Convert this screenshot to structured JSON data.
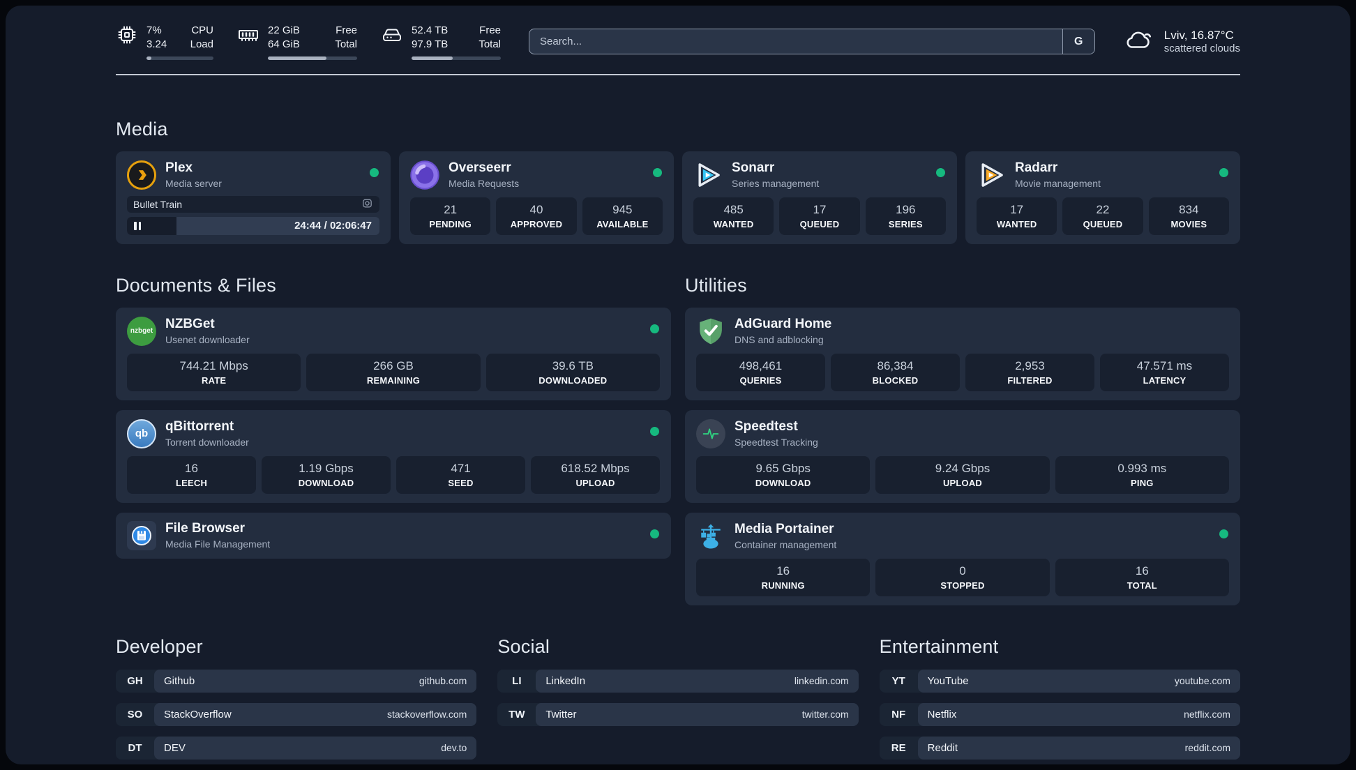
{
  "header": {
    "cpu": {
      "value_top": "7%",
      "value_bottom": "3.24",
      "label_top": "CPU",
      "label_bottom": "Load",
      "progress": 7
    },
    "ram": {
      "value_top": "22 GiB",
      "value_bottom": "64 GiB",
      "label_top": "Free",
      "label_bottom": "Total",
      "progress": 66
    },
    "disk": {
      "value_top": "52.4 TB",
      "value_bottom": "97.9 TB",
      "label_top": "Free",
      "label_bottom": "Total",
      "progress": 46
    },
    "search": {
      "placeholder": "Search...",
      "engine": "G"
    },
    "weather": {
      "location_temp": "Lviv, 16.87°C",
      "condition": "scattered clouds"
    }
  },
  "media": {
    "title": "Media",
    "plex": {
      "title": "Plex",
      "subtitle": "Media server",
      "now_playing": "Bullet Train",
      "time": "24:44 / 02:06:47",
      "progress": 19.5
    },
    "overseerr": {
      "title": "Overseerr",
      "subtitle": "Media Requests",
      "stats": [
        {
          "value": "21",
          "label": "PENDING"
        },
        {
          "value": "40",
          "label": "APPROVED"
        },
        {
          "value": "945",
          "label": "AVAILABLE"
        }
      ]
    },
    "sonarr": {
      "title": "Sonarr",
      "subtitle": "Series management",
      "stats": [
        {
          "value": "485",
          "label": "WANTED"
        },
        {
          "value": "17",
          "label": "QUEUED"
        },
        {
          "value": "196",
          "label": "SERIES"
        }
      ]
    },
    "radarr": {
      "title": "Radarr",
      "subtitle": "Movie management",
      "stats": [
        {
          "value": "17",
          "label": "WANTED"
        },
        {
          "value": "22",
          "label": "QUEUED"
        },
        {
          "value": "834",
          "label": "MOVIES"
        }
      ]
    }
  },
  "documents": {
    "title": "Documents & Files",
    "nzbget": {
      "title": "NZBGet",
      "subtitle": "Usenet downloader",
      "icon_text": "nzbget",
      "stats": [
        {
          "value": "744.21 Mbps",
          "label": "RATE"
        },
        {
          "value": "266 GB",
          "label": "REMAINING"
        },
        {
          "value": "39.6 TB",
          "label": "DOWNLOADED"
        }
      ]
    },
    "qbittorrent": {
      "title": "qBittorrent",
      "subtitle": "Torrent downloader",
      "icon_text": "qb",
      "stats": [
        {
          "value": "16",
          "label": "LEECH"
        },
        {
          "value": "1.19 Gbps",
          "label": "DOWNLOAD"
        },
        {
          "value": "471",
          "label": "SEED"
        },
        {
          "value": "618.52 Mbps",
          "label": "UPLOAD"
        }
      ]
    },
    "filebrowser": {
      "title": "File Browser",
      "subtitle": "Media File Management"
    }
  },
  "utilities": {
    "title": "Utilities",
    "adguard": {
      "title": "AdGuard Home",
      "subtitle": "DNS and adblocking",
      "stats": [
        {
          "value": "498,461",
          "label": "QUERIES"
        },
        {
          "value": "86,384",
          "label": "BLOCKED"
        },
        {
          "value": "2,953",
          "label": "FILTERED"
        },
        {
          "value": "47.571 ms",
          "label": "LATENCY"
        }
      ]
    },
    "speedtest": {
      "title": "Speedtest",
      "subtitle": "Speedtest Tracking",
      "stats": [
        {
          "value": "9.65 Gbps",
          "label": "DOWNLOAD"
        },
        {
          "value": "9.24 Gbps",
          "label": "UPLOAD"
        },
        {
          "value": "0.993 ms",
          "label": "PING"
        }
      ]
    },
    "portainer": {
      "title": "Media Portainer",
      "subtitle": "Container management",
      "stats": [
        {
          "value": "16",
          "label": "RUNNING"
        },
        {
          "value": "0",
          "label": "STOPPED"
        },
        {
          "value": "16",
          "label": "TOTAL"
        }
      ]
    }
  },
  "links": {
    "developer": {
      "title": "Developer",
      "items": [
        {
          "tag": "GH",
          "name": "Github",
          "url": "github.com"
        },
        {
          "tag": "SO",
          "name": "StackOverflow",
          "url": "stackoverflow.com"
        },
        {
          "tag": "DT",
          "name": "DEV",
          "url": "dev.to"
        }
      ]
    },
    "social": {
      "title": "Social",
      "items": [
        {
          "tag": "LI",
          "name": "LinkedIn",
          "url": "linkedin.com"
        },
        {
          "tag": "TW",
          "name": "Twitter",
          "url": "twitter.com"
        }
      ]
    },
    "entertainment": {
      "title": "Entertainment",
      "items": [
        {
          "tag": "YT",
          "name": "YouTube",
          "url": "youtube.com"
        },
        {
          "tag": "NF",
          "name": "Netflix",
          "url": "netflix.com"
        },
        {
          "tag": "RE",
          "name": "Reddit",
          "url": "reddit.com"
        }
      ]
    }
  },
  "colors": {
    "status_online": "#16b97f",
    "plex_amber": "#e5a00d",
    "sonarr_cyan": "#35c5f4",
    "radarr_amber": "#f7a824",
    "nzbget_green": "#3d9c40",
    "qbittorrent_blue": "#4a90d9",
    "adguard_green": "#67b279",
    "speedtest_pulse": "#2fd180",
    "portainer_blue": "#3db0e6",
    "filebrowser_blue": "#2f89e5"
  }
}
